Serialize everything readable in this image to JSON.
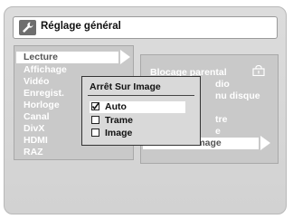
{
  "header": {
    "title": "Réglage général",
    "icon": "wrench-icon"
  },
  "main_menu": {
    "items": [
      {
        "label": "Lecture",
        "selected": true
      },
      {
        "label": "Affichage",
        "selected": false
      },
      {
        "label": "Vidéo",
        "selected": false
      },
      {
        "label": "Enregist.",
        "selected": false
      },
      {
        "label": "Horloge",
        "selected": false
      },
      {
        "label": "Canal",
        "selected": false
      },
      {
        "label": "DivX",
        "selected": false
      },
      {
        "label": "HDMI",
        "selected": false
      },
      {
        "label": "RAZ",
        "selected": false
      }
    ]
  },
  "sub_menu": {
    "items": [
      {
        "label": "Blocage parental",
        "icon": "lock-icon"
      },
      {
        "label": "dio"
      },
      {
        "label": "nu disque"
      },
      {
        "label": "tre"
      },
      {
        "label": "e"
      },
      {
        "label": "Arrêt Sur Image",
        "selected": true
      }
    ]
  },
  "popup": {
    "title": "Arrêt Sur Image",
    "options": [
      {
        "label": "Auto",
        "checked": true,
        "selected": true
      },
      {
        "label": "Trame",
        "checked": false,
        "selected": false
      },
      {
        "label": "Image",
        "checked": false,
        "selected": false
      }
    ]
  },
  "colors": {
    "background": "#d2d2d2",
    "panel": "#c9c9c9",
    "text_inactive": "#ffffff",
    "text_active": "#555555"
  }
}
